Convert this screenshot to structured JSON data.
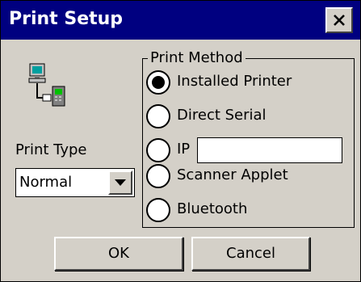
{
  "window": {
    "title": "Print Setup",
    "close_icon": "close-icon",
    "colors": {
      "titlebar": "#000080",
      "face": "#d4d0c8",
      "field": "#ffffff"
    }
  },
  "print_type": {
    "label": "Print Type",
    "selected": "Normal",
    "dropdown_icon": "chevron-down-icon"
  },
  "print_method": {
    "label": "Print Method",
    "selected_index": 0,
    "options": [
      {
        "label": "Installed Printer",
        "selected": true
      },
      {
        "label": "Direct Serial",
        "selected": false
      },
      {
        "label": "IP",
        "selected": false
      },
      {
        "label": "Scanner Applet",
        "selected": false
      },
      {
        "label": "Bluetooth",
        "selected": false
      }
    ],
    "ip_value": ""
  },
  "buttons": {
    "ok_label": "OK",
    "cancel_label": "Cancel"
  },
  "icons": {
    "printer": "printer-computer-icon"
  }
}
